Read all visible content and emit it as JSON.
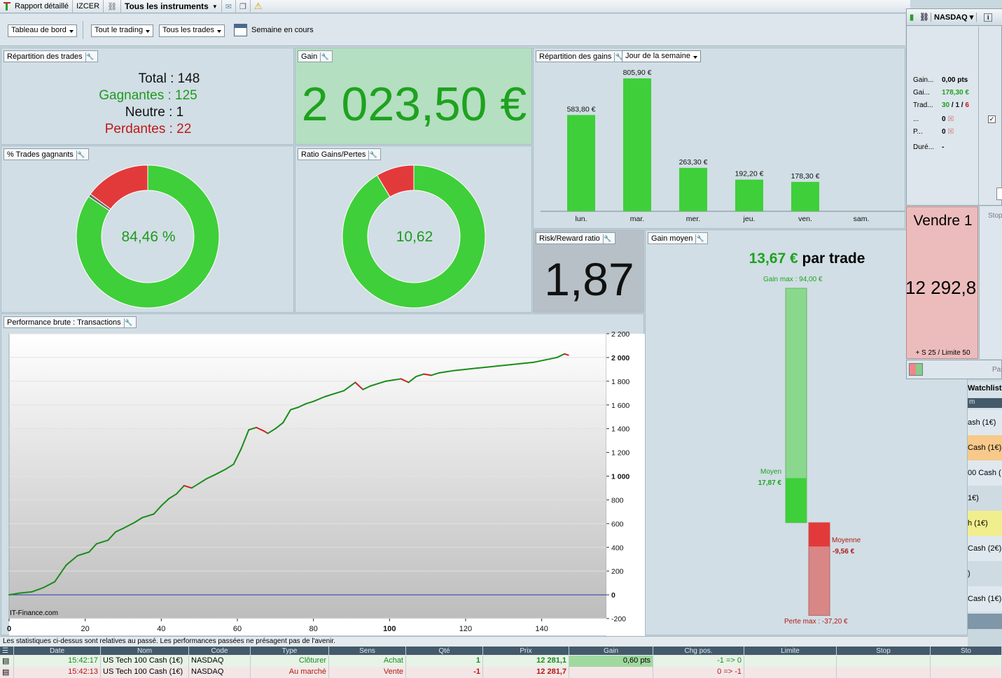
{
  "topbar": {
    "report": "Rapport détaillé",
    "account": "IZCER",
    "instruments": "Tous les instruments"
  },
  "toolbar": {
    "dashboard": "Tableau de bord",
    "trading": "Tout le trading",
    "trades": "Tous les trades",
    "period": "Semaine en cours"
  },
  "repartition": {
    "title": "Répartition des trades",
    "total": "Total : 148",
    "winners": "Gagnantes : 125",
    "neutral": "Neutre : 1",
    "losers": "Perdantes : 22"
  },
  "gain": {
    "title": "Gain",
    "value": "2 023,50 €"
  },
  "gains_dist": {
    "title": "Répartition des gains",
    "selector": "Jour de la semaine"
  },
  "win_pct": {
    "title": "% Trades gagnants",
    "value": "84,46 %",
    "fraction": 0.8446
  },
  "ratio": {
    "title": "Ratio Gains/Pertes",
    "value": "10,62"
  },
  "risk": {
    "title": "Risk/Reward ratio",
    "value": "1,87"
  },
  "perf": {
    "title": "Performance brute : Transactions",
    "watermark": "IT-Finance.com"
  },
  "gain_moyen": {
    "title": "Gain moyen",
    "value": "13,67 €",
    "suffix": "par trade",
    "gain_max": "Gain max : 94,00 €",
    "moyen_label": "Moyen",
    "moyen_value": "17,87 €",
    "moyenne_label": "Moyenne",
    "moyenne_value": "-9,56 €",
    "perte_max": "Perte max : -37,20 €"
  },
  "disclaimer": "Les statistiques ci-dessus sont relatives au passé. Les performances passées ne présagent pas de l'avenir.",
  "side": {
    "instrument": "NASDAQ",
    "rows": [
      {
        "label": "Gain...",
        "value": "0,00 pts"
      },
      {
        "label": "Gai...",
        "value": "178,30 €"
      },
      {
        "label": "Trad...",
        "value": "30 / 1 / 6"
      },
      {
        "label": "...",
        "value": "0"
      },
      {
        "label": "P...",
        "value": "0"
      },
      {
        "label": "Duré...",
        "value": "-"
      }
    ],
    "sell_title": "Vendre 1",
    "sell_price": "12 292,8",
    "sell_footer": "+ S 25 / Limite 50",
    "stop": "Stop",
    "pas": "Pas",
    "watchlist": "Watchlist",
    "wl_header": "m",
    "wl_items": [
      "ash (1€)",
      "Cash (1€)",
      "00 Cash (",
      "1€)",
      "h (1€)",
      "Cash (2€)",
      ")",
      "Cash (1€)"
    ]
  },
  "table": {
    "headers": [
      "Date",
      "Nom",
      "Code",
      "Type",
      "Sens",
      "Qté",
      "Prix",
      "Gain",
      "Chg pos.",
      "Limite",
      "Stop",
      "Sto"
    ],
    "rows": [
      {
        "time": "15:42:17",
        "name": "US Tech 100 Cash (1€)",
        "code": "NASDAQ",
        "type": "Clôturer",
        "sens": "Achat",
        "qty": "1",
        "price": "12 281,1",
        "gain": "0,60 pts",
        "chg": "-1 => 0"
      },
      {
        "time": "15:42:13",
        "name": "US Tech 100 Cash (1€)",
        "code": "NASDAQ",
        "type": "Au marché",
        "sens": "Vente",
        "qty": "-1",
        "price": "12 281,7",
        "gain": "",
        "chg": "0 => -1"
      }
    ]
  },
  "chart_data": [
    {
      "type": "bar",
      "categories": [
        "lun.",
        "mar.",
        "mer.",
        "jeu.",
        "ven.",
        "sam."
      ],
      "values": [
        583.8,
        805.9,
        263.3,
        192.2,
        178.3,
        0
      ],
      "labels": [
        "583,80 €",
        "805,90 €",
        "263,30 €",
        "192,20 €",
        "178,30 €",
        ""
      ],
      "color": "#3fcf3a"
    },
    {
      "type": "line",
      "x_ticks": [
        "0",
        "20",
        "40",
        "60",
        "80",
        "100",
        "120",
        "140"
      ],
      "y_ticks": [
        "2 200",
        "2 000",
        "1 800",
        "1 600",
        "1 400",
        "1 200",
        "1 000",
        "800",
        "600",
        "400",
        "200",
        "0",
        "-200"
      ],
      "xlim": [
        0,
        157
      ],
      "ylim": [
        -200,
        2200
      ],
      "x": [
        0,
        3,
        6,
        9,
        12,
        15,
        18,
        21,
        23,
        26,
        28,
        30,
        33,
        35,
        38,
        40,
        42,
        44,
        46,
        48,
        50,
        52,
        54,
        57,
        59,
        61,
        63,
        65,
        67,
        68,
        70,
        72,
        74,
        76,
        78,
        80,
        83,
        86,
        88,
        91,
        93,
        95,
        97,
        99,
        101,
        103,
        105,
        107,
        109,
        111,
        113,
        115,
        117,
        120,
        123,
        126,
        129,
        132,
        135,
        138,
        141,
        144,
        146,
        147
      ],
      "y": [
        0,
        15,
        25,
        60,
        110,
        250,
        330,
        360,
        430,
        460,
        530,
        560,
        610,
        650,
        680,
        750,
        810,
        850,
        920,
        900,
        940,
        980,
        1010,
        1060,
        1100,
        1230,
        1390,
        1410,
        1380,
        1360,
        1400,
        1450,
        1560,
        1580,
        1610,
        1630,
        1670,
        1700,
        1720,
        1790,
        1730,
        1760,
        1780,
        1800,
        1810,
        1820,
        1790,
        1840,
        1860,
        1850,
        1870,
        1880,
        1890,
        1900,
        1910,
        1920,
        1930,
        1940,
        1950,
        1960,
        1980,
        2000,
        2030,
        2020
      ],
      "line_color": "#1a8c1a",
      "down_color": "#cc2222"
    },
    {
      "type": "pie",
      "title": "% Trades gagnants",
      "values": [
        84.46,
        0.68,
        14.86
      ],
      "colors": [
        "#3fcf3a",
        "#666666",
        "#e23a3a"
      ]
    },
    {
      "type": "pie",
      "title": "Ratio Gains/Pertes",
      "values": [
        91.39,
        8.61
      ],
      "colors": [
        "#3fcf3a",
        "#e23a3a"
      ]
    },
    {
      "type": "bar",
      "title": "Gain moyen",
      "gain_max": 94.0,
      "gain_avg": 17.87,
      "loss_avg": -9.56,
      "loss_max": -37.2
    }
  ]
}
